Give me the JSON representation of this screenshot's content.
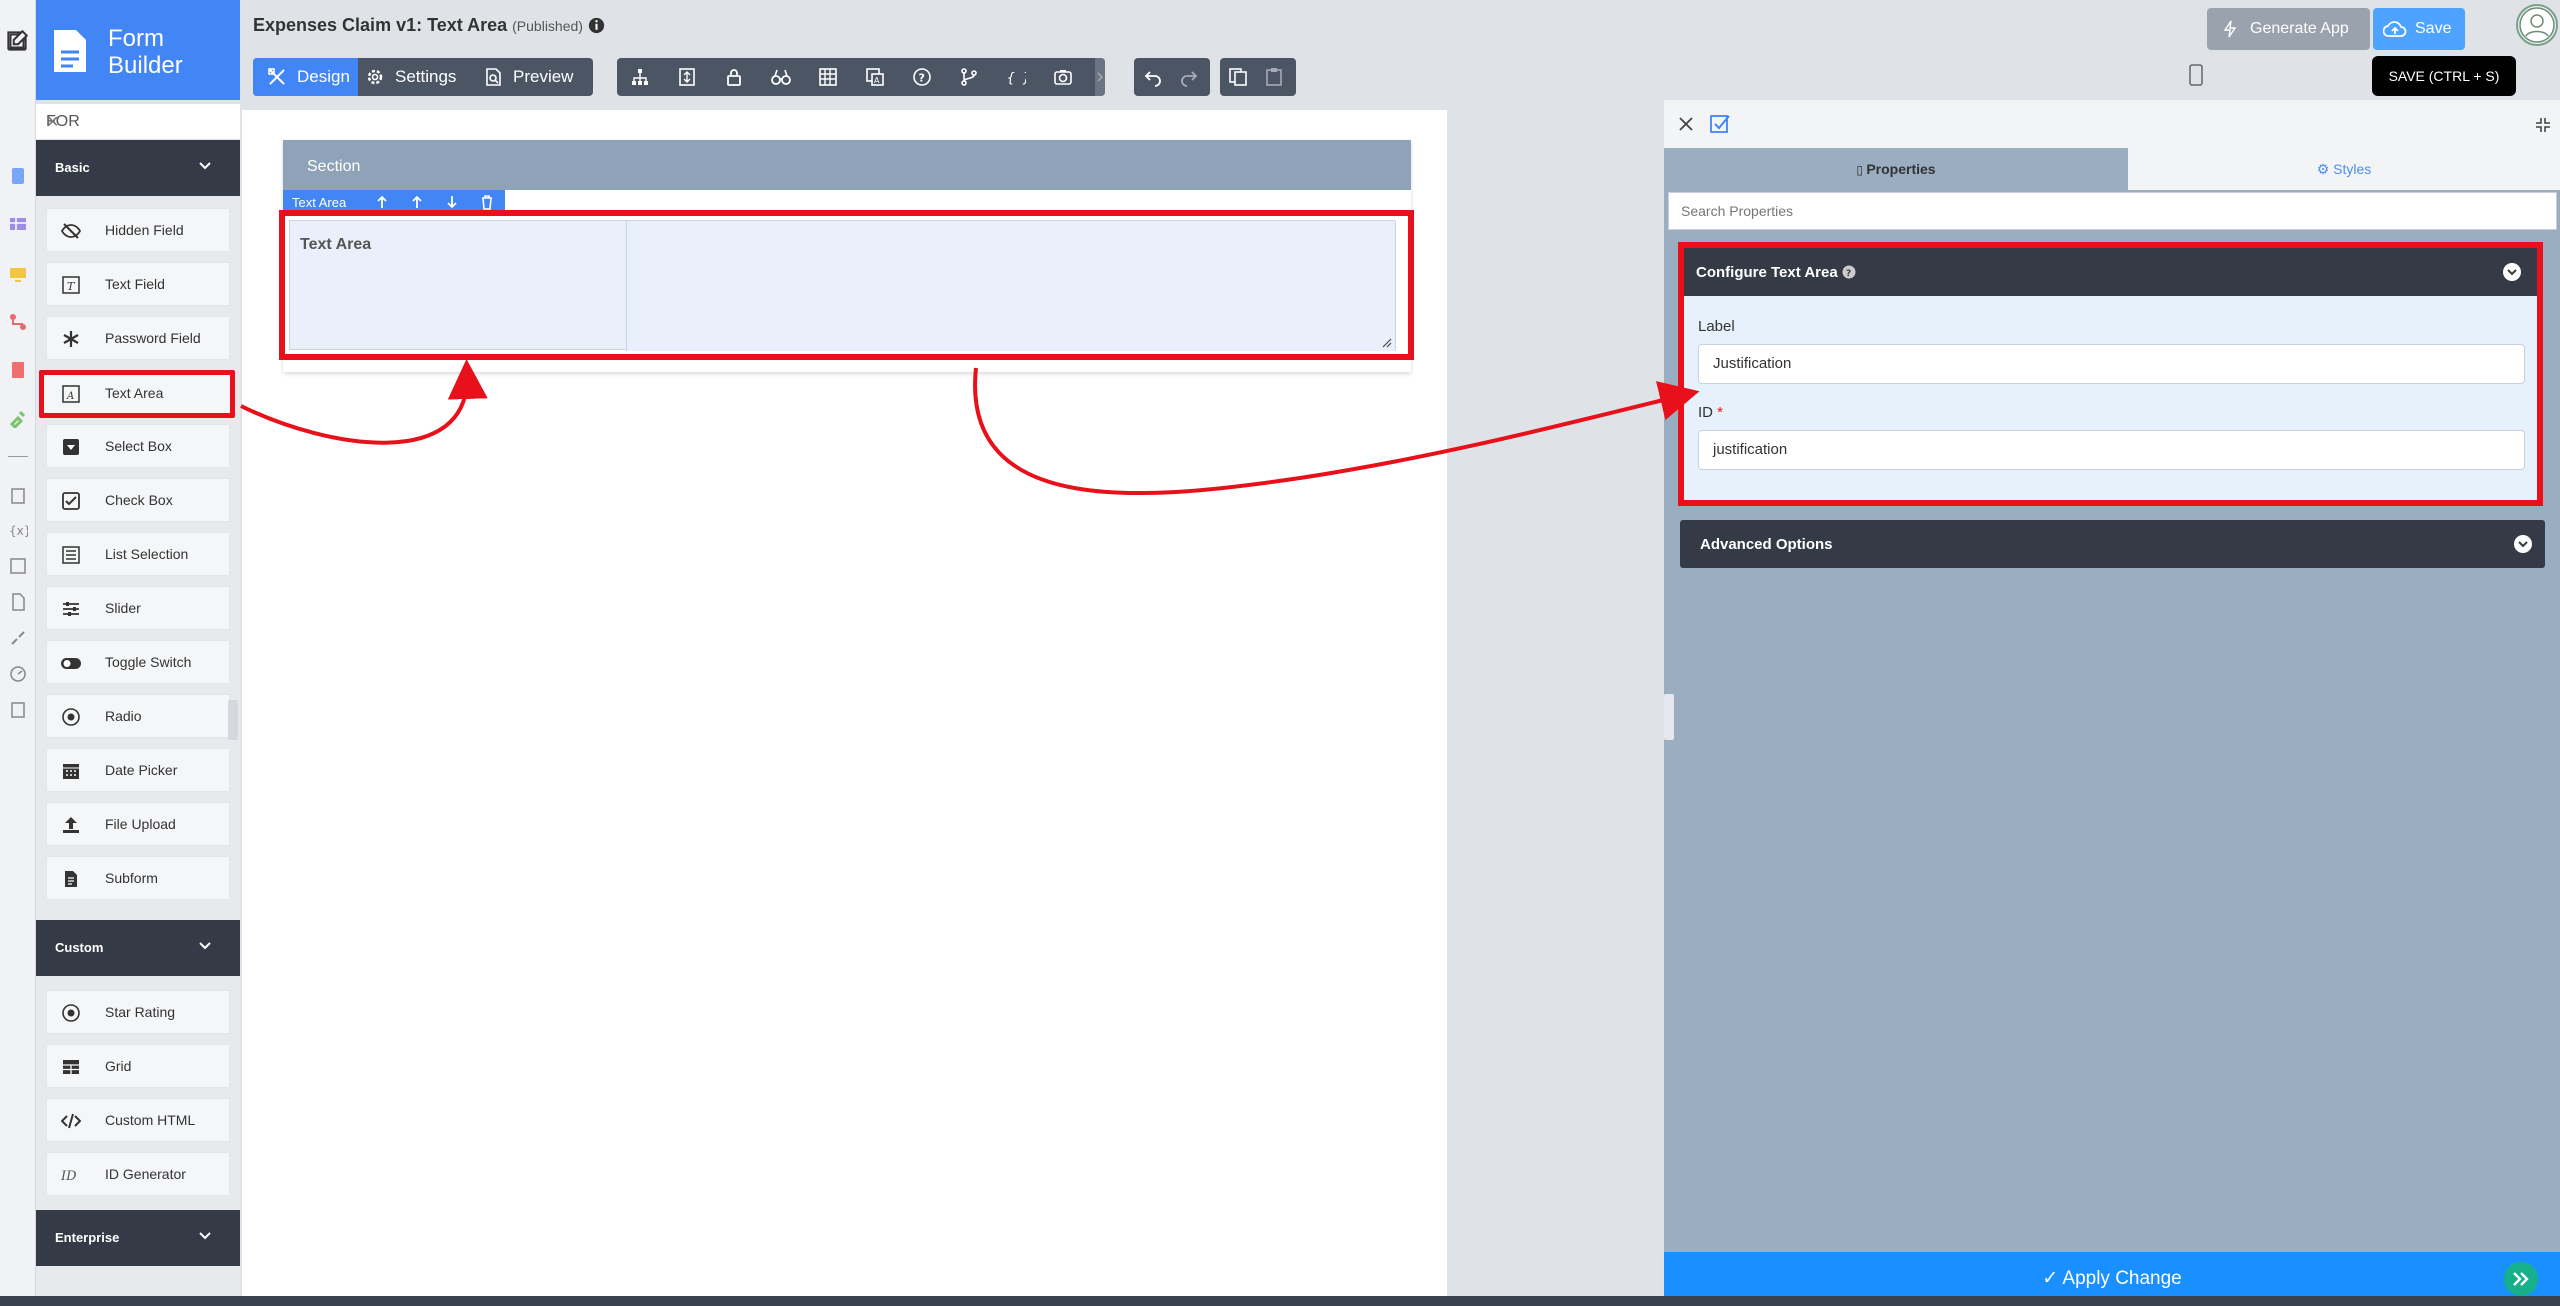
{
  "brand": {
    "line1": "Form",
    "line2": "Builder"
  },
  "palette": {
    "search_value": "FOR",
    "categories": {
      "basic": "Basic",
      "custom": "Custom",
      "enterprise": "Enterprise"
    },
    "basic_items": [
      "Hidden Field",
      "Text Field",
      "Password Field",
      "Text Area",
      "Select Box",
      "Check Box",
      "List Selection",
      "Slider",
      "Toggle Switch",
      "Radio",
      "Date Picker",
      "File Upload",
      "Subform"
    ],
    "custom_items": [
      "Star Rating",
      "Grid",
      "Custom HTML",
      "ID Generator"
    ],
    "selected_item": "Text Area"
  },
  "header": {
    "title": "Expenses Claim v1: Text Area",
    "status": "(Published)",
    "tabs": [
      "Design",
      "Settings",
      "Preview"
    ],
    "generate_app": "Generate App",
    "save": "Save",
    "save_tooltip": "SAVE (CTRL + S)"
  },
  "canvas": {
    "section_title": "Section",
    "field_type_tag": "Text Area",
    "field_label": "Text Area"
  },
  "properties": {
    "tabs": [
      "Properties",
      "Styles"
    ],
    "search_placeholder": "Search Properties",
    "configure_title": "Configure Text Area",
    "label_caption": "Label",
    "label_value": "Justification",
    "id_caption": "ID",
    "id_required_mark": "*",
    "id_value": "justification",
    "advanced_title": "Advanced Options",
    "apply_button": "Apply Change"
  },
  "colors": {
    "accent": "#4285f4",
    "highlight": "#e8101a",
    "dark": "#343a46",
    "panel": "#9aadc1",
    "apply": "#1a8fff"
  }
}
